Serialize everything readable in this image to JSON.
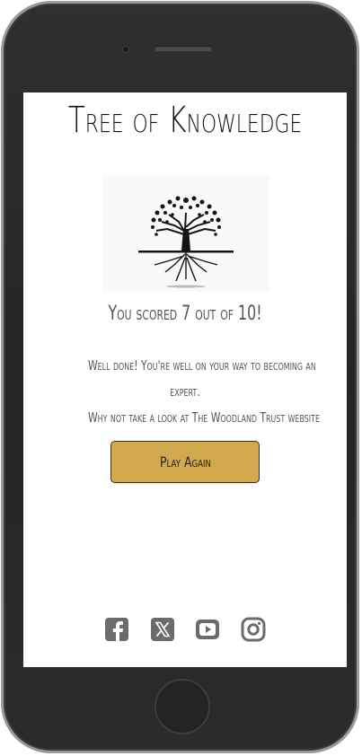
{
  "app": {
    "title": "Tree of Knowledge"
  },
  "result": {
    "score_text": "You scored 7 out of 10!",
    "message_line1": "Well done! You're well on your way to becoming an",
    "message_line2": "expert.",
    "message_line3": "Why not take a look at The Woodland Trust website"
  },
  "actions": {
    "play_again_label": "Play Again"
  },
  "socials": [
    {
      "icon": "facebook-icon"
    },
    {
      "icon": "x-twitter-icon"
    },
    {
      "icon": "youtube-icon"
    },
    {
      "icon": "instagram-icon"
    }
  ],
  "colors": {
    "button": "#d2a84c",
    "icon": "#6b6b6b",
    "text": "#555555"
  }
}
